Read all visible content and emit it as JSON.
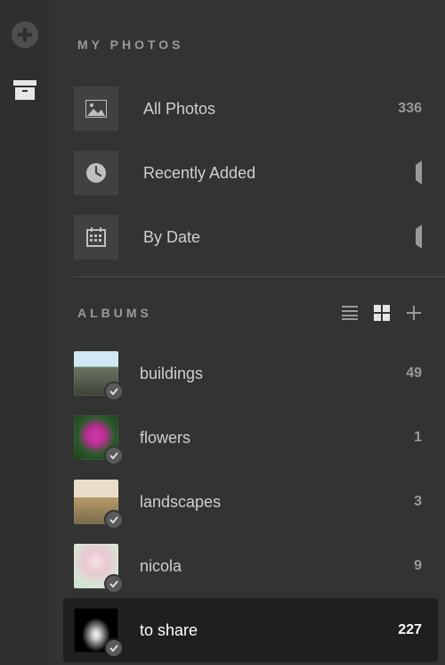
{
  "rail": {
    "add_icon": "plus",
    "archive_icon": "archive"
  },
  "myphotos": {
    "title": "MY PHOTOS",
    "items": [
      {
        "icon": "image",
        "label": "All Photos",
        "meta": "336",
        "meta_kind": "count"
      },
      {
        "icon": "clock",
        "label": "Recently Added",
        "meta": "",
        "meta_kind": "chevron"
      },
      {
        "icon": "calendar",
        "label": "By Date",
        "meta": "",
        "meta_kind": "chevron"
      }
    ]
  },
  "albums": {
    "title": "ALBUMS",
    "items": [
      {
        "label": "buildings",
        "count": "49",
        "selected": false
      },
      {
        "label": "flowers",
        "count": "1",
        "selected": false
      },
      {
        "label": "landscapes",
        "count": "3",
        "selected": false
      },
      {
        "label": "nicola",
        "count": "9",
        "selected": false
      },
      {
        "label": "to share",
        "count": "227",
        "selected": true
      }
    ]
  }
}
